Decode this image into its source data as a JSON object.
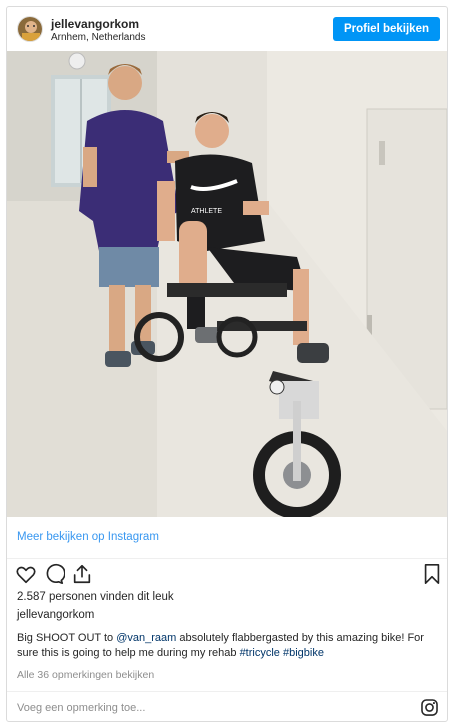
{
  "post": {
    "username": "jellevangorkom",
    "location": "Arnhem, Netherlands",
    "profile_button": "Profiel bekijken",
    "view_more_link": "Meer bekijken op Instagram",
    "likes_text": "2.587 personen vinden dit leuk",
    "caption_user": "jellevangorkom",
    "caption": {
      "part1": "Big SHOOT OUT to ",
      "mention": "@van_raam",
      "part2": " absolutely flabbergasted by this amazing bike! For sure this is going to help me during my rehab ",
      "tag1": "#tricycle",
      "sep": " ",
      "tag2": "#bigbike"
    },
    "all_comments": "Alle 36 opmerkingen bekijken",
    "comment_placeholder": "Voeg een opmerking toe...",
    "shirt_text": "ATHLETE"
  },
  "icons": {
    "like": "heart-icon",
    "comment": "comment-icon",
    "share": "share-icon",
    "save": "bookmark-icon",
    "instagram": "instagram-icon"
  },
  "colors": {
    "accent": "#0095f6",
    "link": "#3897f0",
    "hashtag": "#003569",
    "muted": "#8e8e8e"
  }
}
